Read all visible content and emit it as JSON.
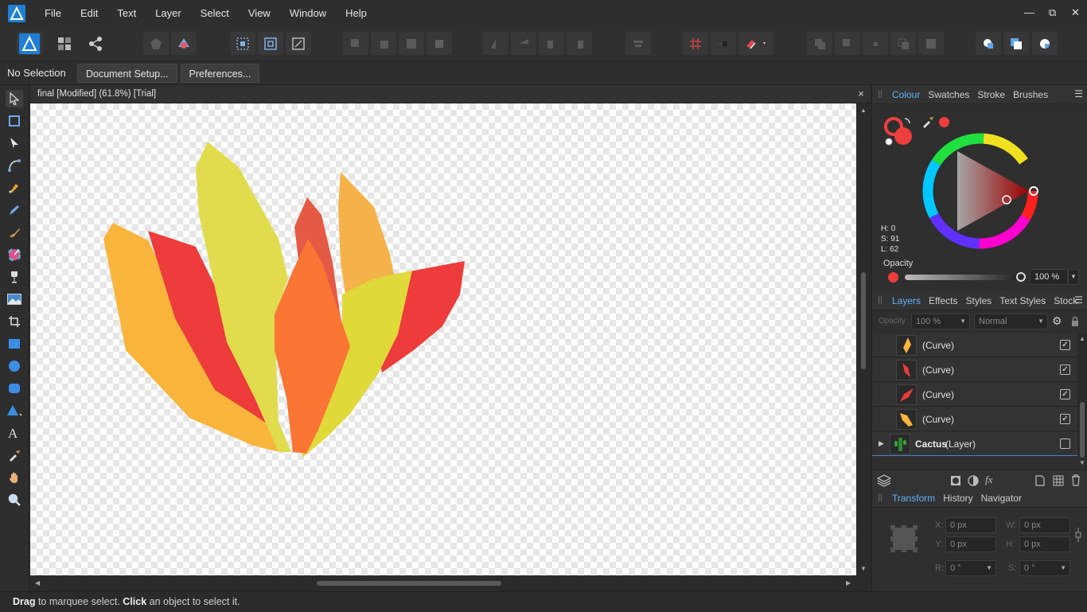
{
  "menubar": {
    "items": [
      "File",
      "Edit",
      "Text",
      "Layer",
      "Select",
      "View",
      "Window",
      "Help"
    ],
    "window_controls": {
      "minimize": "—",
      "restore": "⧉",
      "close": "✕"
    }
  },
  "context_bar": {
    "selection_label": "No Selection",
    "document_setup_label": "Document Setup...",
    "preferences_label": "Preferences..."
  },
  "document": {
    "tab_title": "final [Modified] (61.8%) [Trial]",
    "close_glyph": "×"
  },
  "colour_panel": {
    "tabs": [
      "Colour",
      "Swatches",
      "Stroke",
      "Brushes"
    ],
    "active_tab": "Colour",
    "h_label": "H: 0",
    "s_label": "S: 91",
    "l_label": "L: 62",
    "opacity_label": "Opacity",
    "opacity_value": "100 %",
    "current_color": "#ef3e3e"
  },
  "layers_panel": {
    "tabs": [
      "Layers",
      "Effects",
      "Styles",
      "Text Styles",
      "Stock"
    ],
    "active_tab": "Layers",
    "opacity_label": "Opacity",
    "opacity_value": "100 %",
    "blend_mode": "Normal",
    "layers": [
      {
        "name": "(Curve)",
        "checked": "✓",
        "color": "#f9b43c",
        "icon": "leaf-orange"
      },
      {
        "name": "(Curve)",
        "checked": "✓",
        "color": "#ee3b3b",
        "icon": "leaf-red"
      },
      {
        "name": "(Curve)",
        "checked": "✓",
        "color": "#ee3b3b",
        "icon": "leaf-red"
      },
      {
        "name": "(Curve)",
        "checked": "✓",
        "color": "#f9b43c",
        "icon": "leaf-orange"
      }
    ],
    "group_layer": {
      "name": "Cactus",
      "type": "(Layer)",
      "checked": ""
    }
  },
  "transform_panel": {
    "tabs": [
      "Transform",
      "History",
      "Navigator"
    ],
    "active_tab": "Transform",
    "x_label": "X:",
    "x_value": "0 px",
    "y_label": "Y:",
    "y_value": "0 px",
    "w_label": "W:",
    "w_value": "0 px",
    "h_label": "H:",
    "h_value": "0 px",
    "r_label": "R:",
    "r_value": "0 °",
    "s_label": "S:",
    "s_value": "0 °"
  },
  "status_bar": {
    "drag_word": "Drag",
    "drag_text": " to marquee select. ",
    "click_word": "Click",
    "click_text": " an object to select it."
  },
  "artwork_colors": {
    "orange": "#f9b43c",
    "red": "#ee3b3b",
    "yellow": "#e0dc4e",
    "deep_orange": "#fb7535",
    "tomato": "#e55a44",
    "light_orange": "#f6b24a",
    "lemon": "#e0d93a"
  }
}
